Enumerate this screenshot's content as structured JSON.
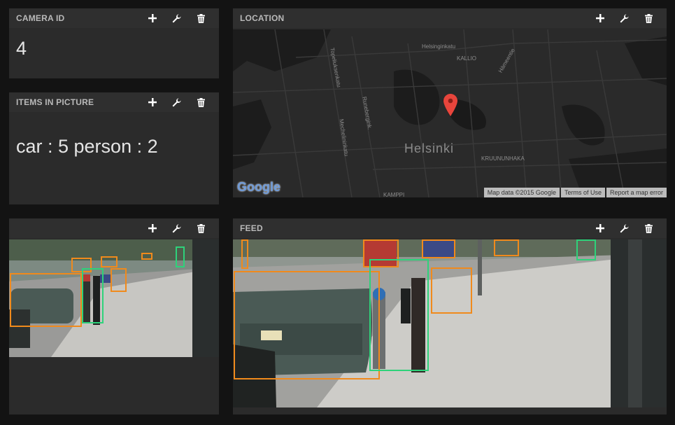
{
  "widgets": {
    "camera_id": {
      "title": "CAMERA ID",
      "value": "4"
    },
    "items": {
      "title": "ITEMS IN PICTURE",
      "value": "car : 5 person : 2"
    },
    "location": {
      "title": "LOCATION",
      "city": "Helsinki",
      "labels": [
        "Helsinginkatu",
        "KALLIO",
        "Hämeentie",
        "Topeliuksenkatu",
        "Runebergink.",
        "Mechelininkatu",
        "KRUUNUNHAKA",
        "KAMPPI"
      ],
      "logo": "Google",
      "attribution": [
        "Map data ©2015 Google",
        "Terms of Use",
        "Report a map error"
      ]
    },
    "thumb": {
      "title": ""
    },
    "feed": {
      "title": "FEED"
    }
  },
  "icons": {
    "add": "plus-icon",
    "settings": "wrench-icon",
    "delete": "trash-icon"
  },
  "colors": {
    "car_box": "#f08a1c",
    "person_box": "#2ed27a",
    "map_pin": "#e8453c"
  }
}
